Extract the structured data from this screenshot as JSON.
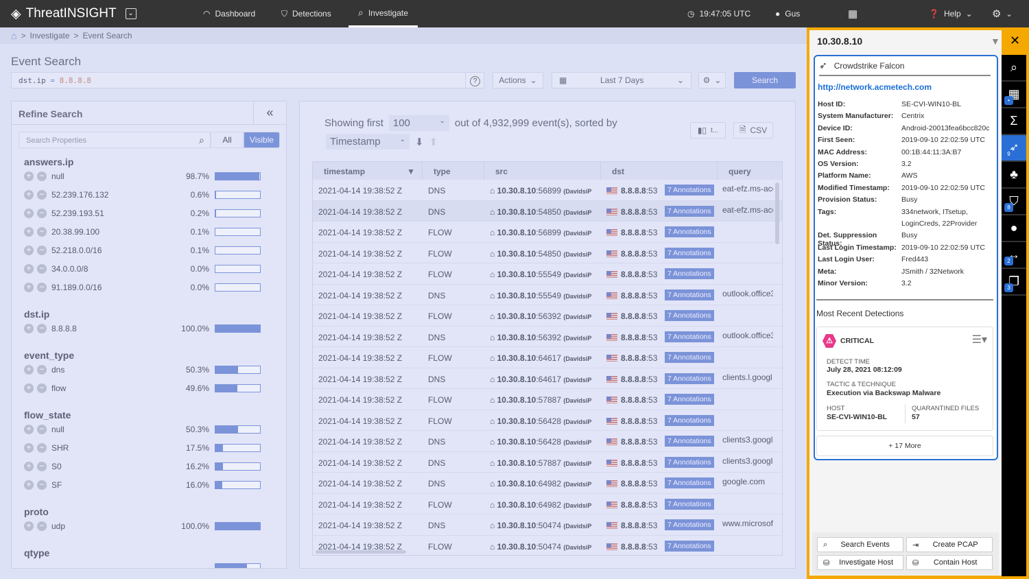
{
  "topbar": {
    "app": "ThreatINSIGHT",
    "nav": [
      {
        "label": "Dashboard",
        "icon": "gauge-icon"
      },
      {
        "label": "Detections",
        "icon": "shield-icon"
      },
      {
        "label": "Investigate",
        "icon": "search-icon",
        "active": true
      }
    ],
    "time": "19:47:05 UTC",
    "user": "Gus",
    "help": "Help"
  },
  "breadcrumb": {
    "items": [
      "Investigate",
      "Event Search"
    ],
    "sep": ">"
  },
  "page_title": "Event Search",
  "query": {
    "field": "dst.ip",
    "op": "=",
    "value": "8.8.8.8"
  },
  "toolbar": {
    "help": "?",
    "actions": "Actions",
    "range": "Last 7 Days",
    "search": "Search"
  },
  "refine": {
    "title": "Refine Search",
    "search_placeholder": "Search Properties",
    "toggle": [
      "All",
      "Visible"
    ],
    "active_toggle": "Visible",
    "groups": [
      {
        "name": "answers.ip",
        "items": [
          {
            "label": "null",
            "pct": "98.7%",
            "v": 98.7
          },
          {
            "label": "52.239.176.132",
            "pct": "0.6%",
            "v": 0.6
          },
          {
            "label": "52.239.193.51",
            "pct": "0.2%",
            "v": 0.2
          },
          {
            "label": "20.38.99.100",
            "pct": "0.1%",
            "v": 0.1
          },
          {
            "label": "52.218.0.0/16",
            "pct": "0.1%",
            "v": 0.1
          },
          {
            "label": "34.0.0.0/8",
            "pct": "0.0%",
            "v": 0
          },
          {
            "label": "91.189.0.0/16",
            "pct": "0.0%",
            "v": 0
          }
        ]
      },
      {
        "name": "dst.ip",
        "items": [
          {
            "label": "8.8.8.8",
            "pct": "100.0%",
            "v": 100
          }
        ]
      },
      {
        "name": "event_type",
        "items": [
          {
            "label": "dns",
            "pct": "50.3%",
            "v": 50.3
          },
          {
            "label": "flow",
            "pct": "49.6%",
            "v": 49.6
          }
        ]
      },
      {
        "name": "flow_state",
        "items": [
          {
            "label": "null",
            "pct": "50.3%",
            "v": 50.3
          },
          {
            "label": "SHR",
            "pct": "17.5%",
            "v": 17.5
          },
          {
            "label": "S0",
            "pct": "16.2%",
            "v": 16.2
          },
          {
            "label": "SF",
            "pct": "16.0%",
            "v": 16
          }
        ]
      },
      {
        "name": "proto",
        "items": [
          {
            "label": "udp",
            "pct": "100.0%",
            "v": 100
          }
        ]
      },
      {
        "name": "qtype",
        "items": []
      }
    ]
  },
  "results": {
    "showing": "Showing first",
    "limit": "100",
    "total": "out of 4,932,999 event(s), sorted by",
    "sort": "Timestamp",
    "columns_btn": "t...",
    "csv": "CSV",
    "columns": [
      "timestamp",
      "type",
      "src",
      "dst",
      "query"
    ],
    "rows": [
      {
        "ts": "2021-04-14 19:38:52 Z",
        "type": "DNS",
        "port": "56899",
        "q": "eat-efz.ms-acc"
      },
      {
        "ts": "2021-04-14 19:38:52 Z",
        "type": "DNS",
        "port": "54850",
        "q": "eat-efz.ms-acc"
      },
      {
        "ts": "2021-04-14 19:38:52 Z",
        "type": "FLOW",
        "port": "56899",
        "q": ""
      },
      {
        "ts": "2021-04-14 19:38:52 Z",
        "type": "FLOW",
        "port": "54850",
        "q": ""
      },
      {
        "ts": "2021-04-14 19:38:52 Z",
        "type": "FLOW",
        "port": "55549",
        "q": ""
      },
      {
        "ts": "2021-04-14 19:38:52 Z",
        "type": "DNS",
        "port": "55549",
        "q": "outlook.office3"
      },
      {
        "ts": "2021-04-14 19:38:52 Z",
        "type": "FLOW",
        "port": "56392",
        "q": ""
      },
      {
        "ts": "2021-04-14 19:38:52 Z",
        "type": "DNS",
        "port": "56392",
        "q": "outlook.office3"
      },
      {
        "ts": "2021-04-14 19:38:52 Z",
        "type": "FLOW",
        "port": "64617",
        "q": ""
      },
      {
        "ts": "2021-04-14 19:38:52 Z",
        "type": "DNS",
        "port": "64617",
        "q": "clients.l.googl"
      },
      {
        "ts": "2021-04-14 19:38:52 Z",
        "type": "FLOW",
        "port": "57887",
        "q": ""
      },
      {
        "ts": "2021-04-14 19:38:52 Z",
        "type": "FLOW",
        "port": "56428",
        "q": ""
      },
      {
        "ts": "2021-04-14 19:38:52 Z",
        "type": "DNS",
        "port": "56428",
        "q": "clients3.googl"
      },
      {
        "ts": "2021-04-14 19:38:52 Z",
        "type": "DNS",
        "port": "57887",
        "q": "clients3.googl"
      },
      {
        "ts": "2021-04-14 19:38:52 Z",
        "type": "DNS",
        "port": "64982",
        "q": "google.com"
      },
      {
        "ts": "2021-04-14 19:38:52 Z",
        "type": "FLOW",
        "port": "64982",
        "q": ""
      },
      {
        "ts": "2021-04-14 19:38:52 Z",
        "type": "DNS",
        "port": "50474",
        "q": "www.microsof"
      },
      {
        "ts": "2021-04-14 19:38:52 Z",
        "type": "FLOW",
        "port": "50474",
        "q": ""
      }
    ],
    "src_ip": "10.30.8.10",
    "src_name": "(DavidsiP",
    "dst_ip": "8.8.8.8",
    "dst_port": ":53",
    "annotations": "7 Annotations"
  },
  "host_panel": {
    "title": "10.30.8.10",
    "source": "Crowdstrike Falcon",
    "link": "http://network.acmetech.com",
    "fields": [
      [
        "Host ID:",
        "SE-CVI-WIN10-BL"
      ],
      [
        "System Manufacturer:",
        "Centrix"
      ],
      [
        "Device ID:",
        "Android-20013fea6bcc820c"
      ],
      [
        "First Seen:",
        "2019-09-10  22:02:59 UTC"
      ],
      [
        "MAC Address:",
        "00:1B:44:11:3A:B7"
      ],
      [
        "OS Version:",
        "3.2"
      ],
      [
        "Platform Name:",
        "AWS"
      ],
      [
        "Modified Timestamp:",
        "2019-09-10  22:02:59 UTC"
      ],
      [
        "Provision Status:",
        "Busy"
      ],
      [
        "Tags:",
        "334network, ITsetup,"
      ],
      [
        "",
        "LoginCreds, 22Provider"
      ],
      [
        "Det. Suppression Status:",
        "Busy"
      ],
      [
        "Last Login Timestamp:",
        "2019-09-10  22:02:59 UTC"
      ],
      [
        "Last Login User:",
        "Fred443"
      ],
      [
        "Meta:",
        "JSmith / 32Network"
      ],
      [
        "Minor Version:",
        "3.2"
      ]
    ],
    "detections_title": "Most Recent Detections",
    "detection": {
      "severity": "CRITICAL",
      "detect_time_label": "DETECT TIME",
      "detect_time": "July 28, 2021 08:12:09",
      "tactic_label": "TACTIC & TECHNIQUE",
      "tactic": "Execution via Backswap Malware",
      "host_label": "HOST",
      "host": "SE-CVI-WIN10-BL",
      "files_label": "QUARANTINED FILES",
      "files": "57"
    },
    "more": "+ 17 More",
    "actions": [
      "Search Events",
      "Create PCAP",
      "Investigate Host",
      "Contain Host"
    ],
    "side_icons": [
      {
        "icon": "search-icon",
        "badge": ""
      },
      {
        "icon": "building-icon",
        "badge": "•"
      },
      {
        "icon": "sigma-icon",
        "badge": ""
      },
      {
        "icon": "falcon-icon",
        "badge": "9",
        "active": true
      },
      {
        "icon": "network-tree-icon",
        "badge": ""
      },
      {
        "icon": "shield-icon",
        "badge": "8"
      },
      {
        "icon": "user-icon",
        "badge": ""
      },
      {
        "icon": "code-arrows-icon",
        "badge": "2"
      },
      {
        "icon": "window-icon",
        "badge": "3"
      }
    ]
  },
  "colors": {
    "accent": "#7b93d8",
    "highlight_border": "#f5a800",
    "panel_border": "#2a6fd6",
    "critical": "#e8388a"
  }
}
